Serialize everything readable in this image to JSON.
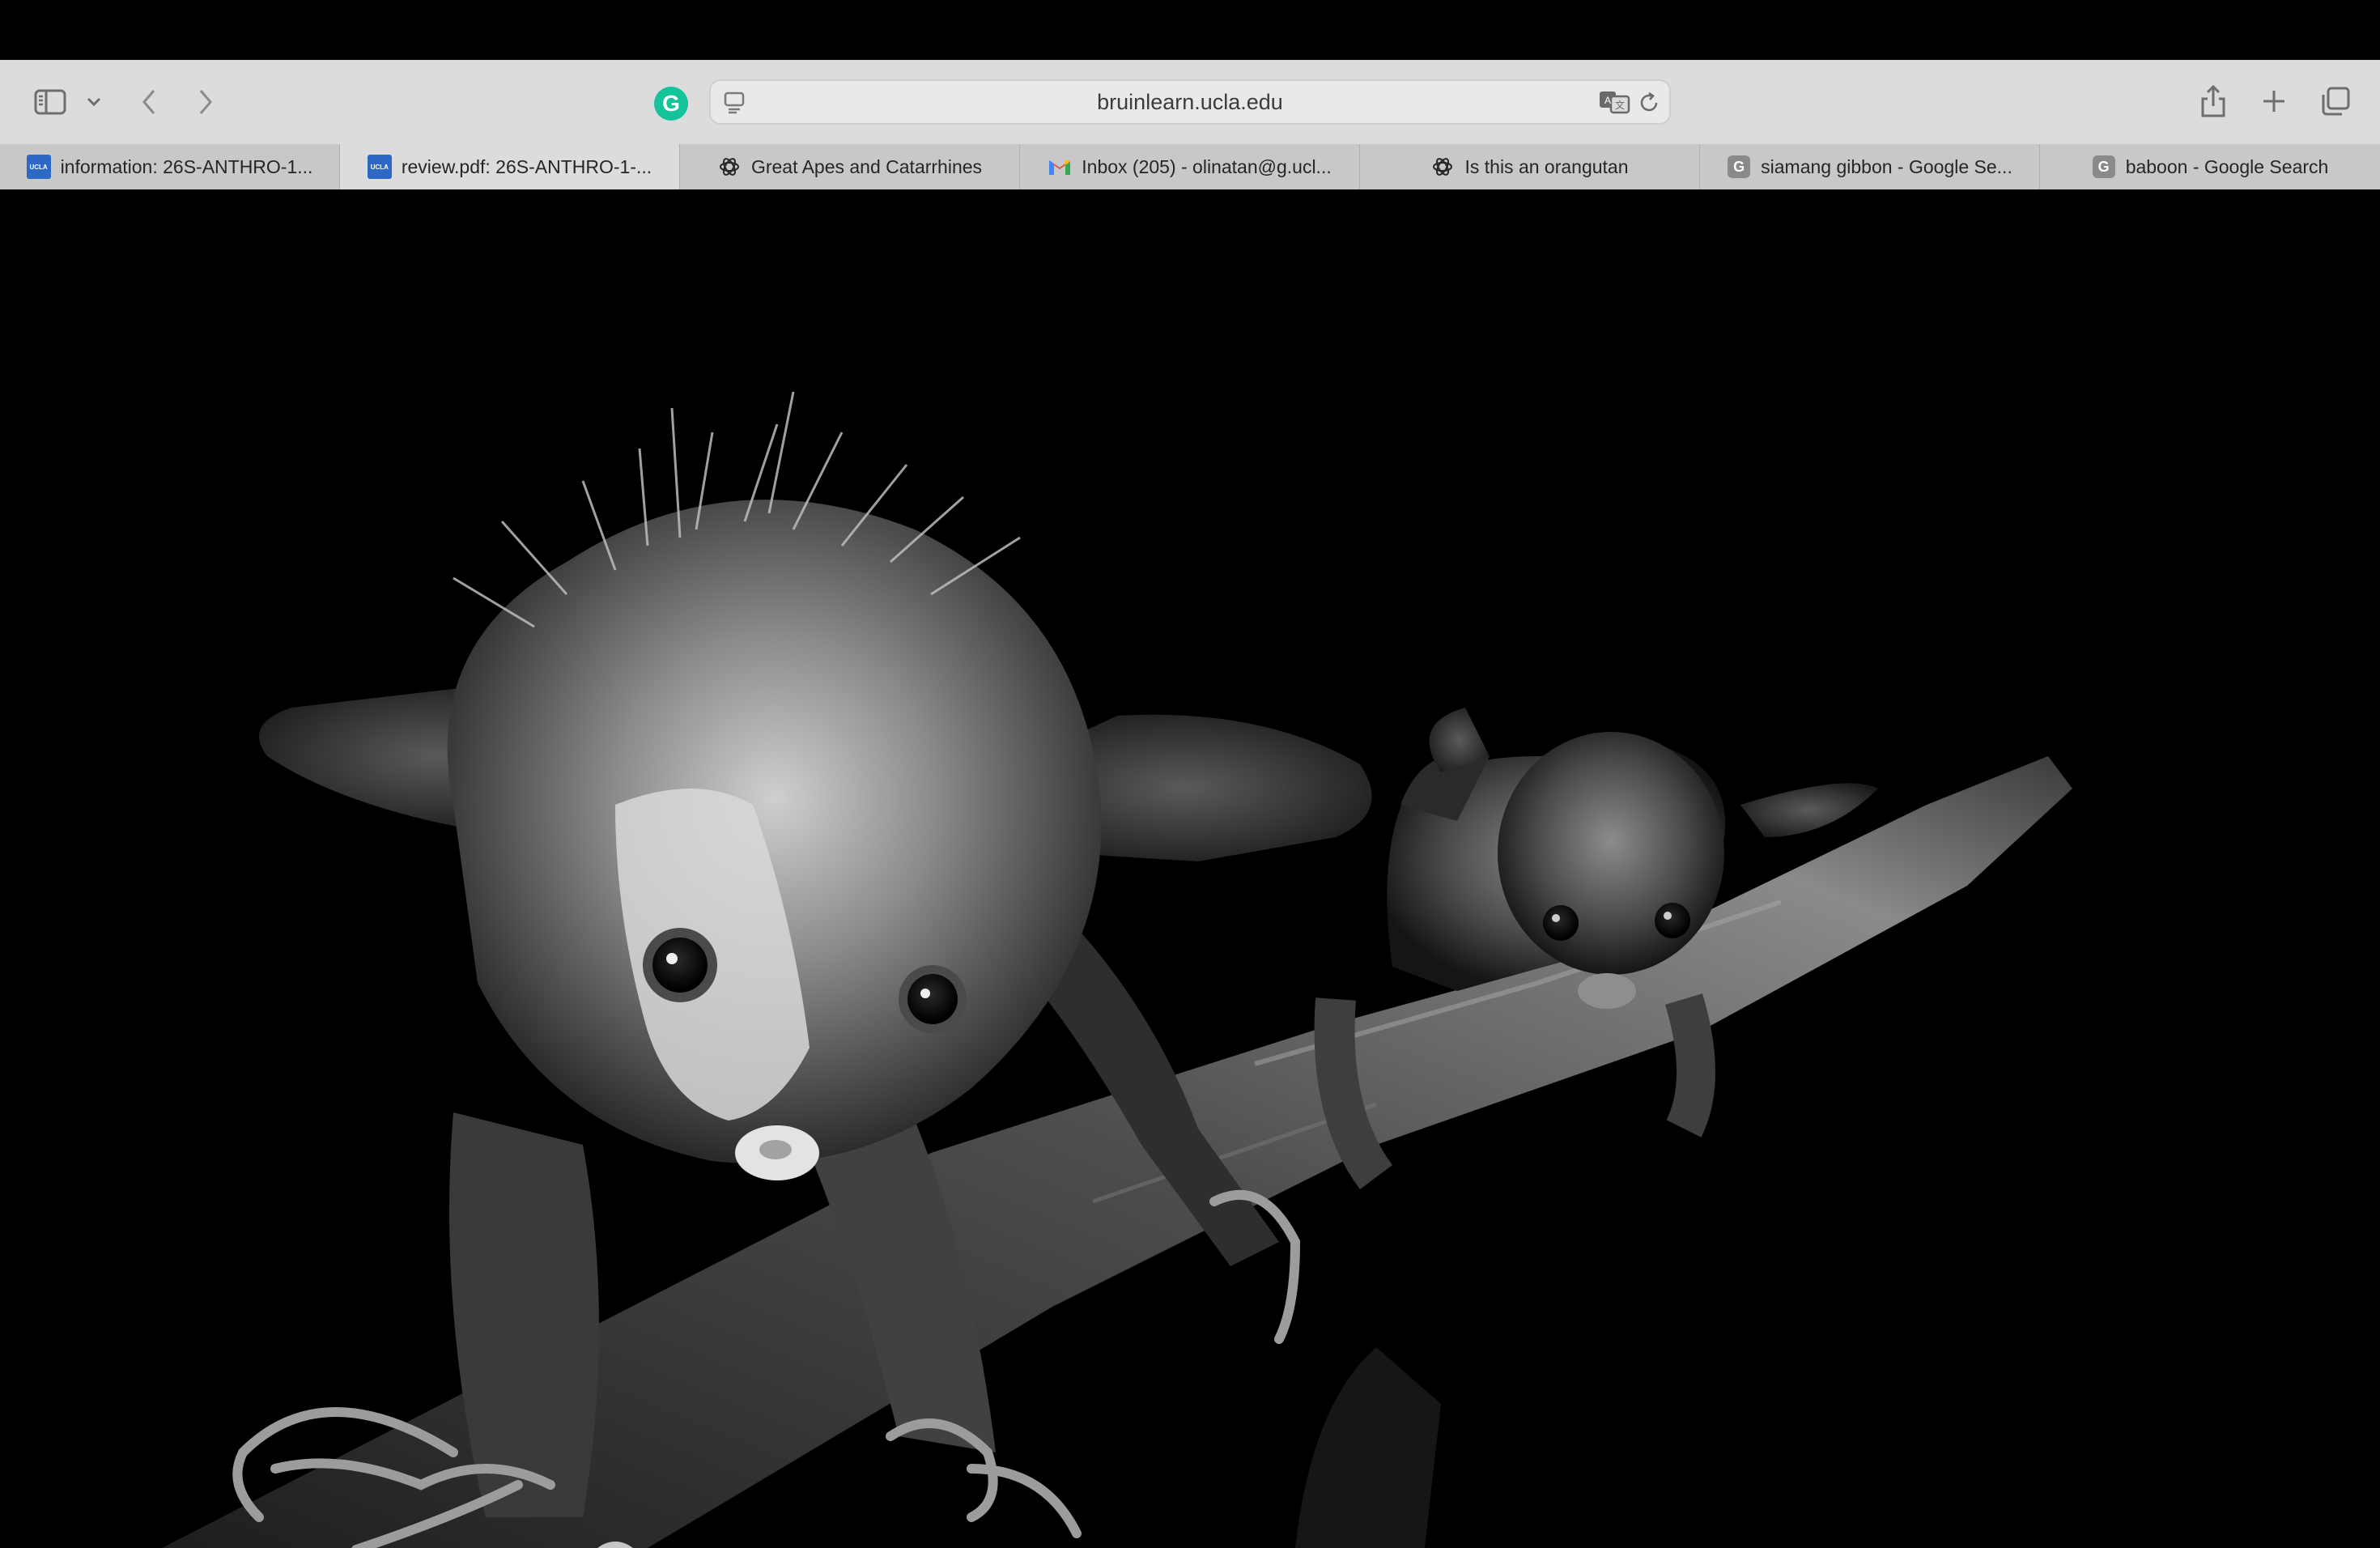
{
  "window": {
    "address_bar": {
      "url": "bruinlearn.ucla.edu"
    },
    "extension": {
      "label": "G"
    }
  },
  "tabs": [
    {
      "favicon": "ucla-logo-icon",
      "favicon_text": "UCLA",
      "title": "information: 26S-ANTHRO-1...",
      "active": false
    },
    {
      "favicon": "ucla-logo-icon",
      "favicon_text": "UCLA",
      "title": "review.pdf: 26S-ANTHRO-1-...",
      "active": true
    },
    {
      "favicon": "chatgpt-icon",
      "title": "Great Apes and Catarrhines",
      "active": false
    },
    {
      "favicon": "gmail-icon",
      "title": "Inbox (205) - olinatan@g.ucl...",
      "active": false
    },
    {
      "favicon": "chatgpt-icon",
      "title": "Is this an orangutan",
      "active": false
    },
    {
      "favicon": "google-icon",
      "favicon_text": "G",
      "title": "siamang gibbon - Google Se...",
      "active": false
    },
    {
      "favicon": "google-icon",
      "favicon_text": "G",
      "title": "baboon - Google Search",
      "active": false
    }
  ],
  "content": {
    "image": {
      "description_icon": "aye-aye-photo",
      "tone": "grayscale"
    }
  },
  "colors": {
    "toolbar_bg": "#dcdcdc",
    "tabbar_bg": "#c8c8c8",
    "content_bg": "#000000",
    "grammarly": "#15c39a",
    "ucla_blue": "#2d68c4"
  }
}
